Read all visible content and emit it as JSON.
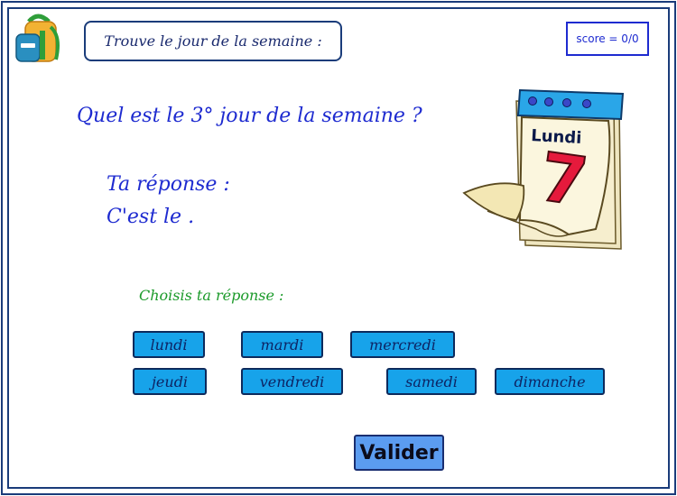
{
  "header": {
    "title": "Trouve le jour de la semaine :",
    "score": "score = 0/0"
  },
  "question": {
    "text": "Quel est le 3° jour de la semaine ?"
  },
  "answer": {
    "line1": "Ta réponse :",
    "line2": "C'est le ."
  },
  "choices": {
    "prompt": "Choisis ta réponse :",
    "days": [
      "lundi",
      "mardi",
      "mercredi",
      "jeudi",
      "vendredi",
      "samedi",
      "dimanche"
    ]
  },
  "validate_label": "Valider",
  "calendar": {
    "day_name": "Lundi",
    "day_number": "7"
  },
  "icons": {
    "logo": "backpack-icon",
    "calendar": "calendar-icon"
  },
  "colors": {
    "frame": "#1a3c7a",
    "question_text": "#1e2bd0",
    "choose_text": "#1b9a2a",
    "day_button": "#17a3ea",
    "validate_button": "#5b9cf0"
  }
}
